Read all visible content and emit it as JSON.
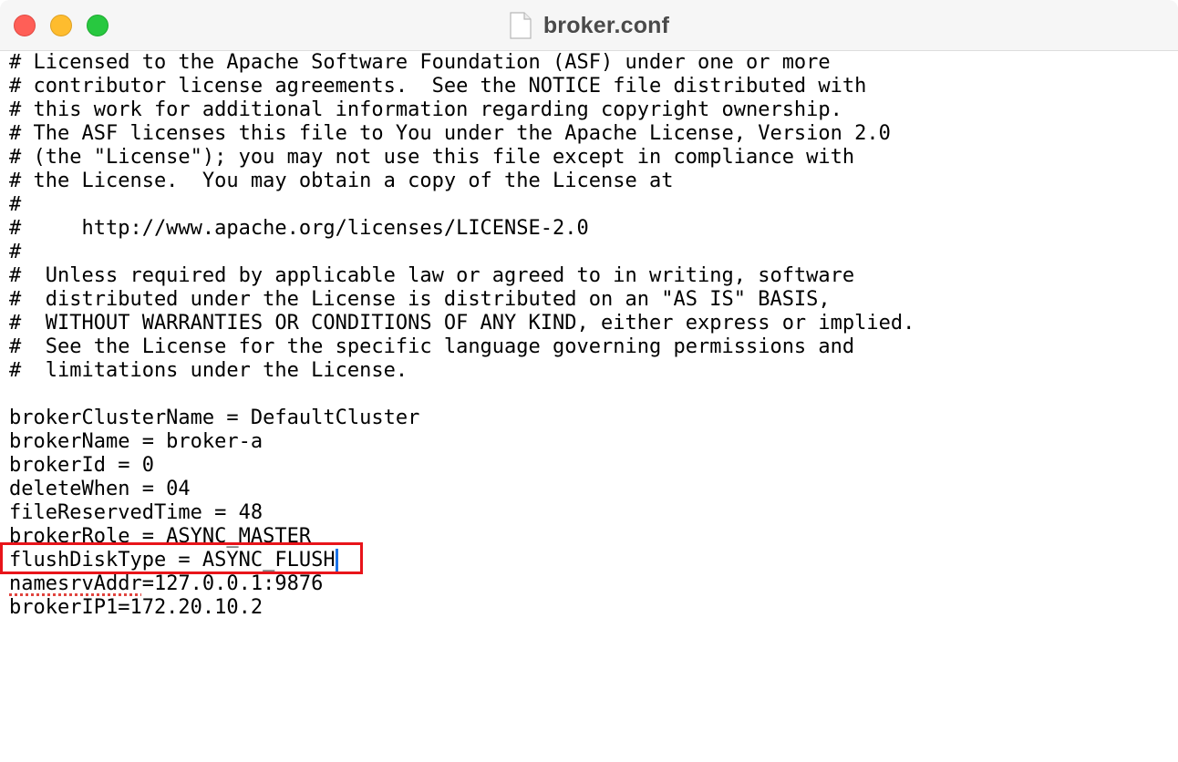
{
  "window": {
    "title": "broker.conf",
    "colors": {
      "close": "#ff5f57",
      "minimize": "#febc2e",
      "zoom": "#28c840",
      "highlight": "#e8141a",
      "cursor": "#1a73e8"
    }
  },
  "editor": {
    "lines": [
      "# Licensed to the Apache Software Foundation (ASF) under one or more",
      "# contributor license agreements.  See the NOTICE file distributed with",
      "# this work for additional information regarding copyright ownership.",
      "# The ASF licenses this file to You under the Apache License, Version 2.0",
      "# (the \"License\"); you may not use this file except in compliance with",
      "# the License.  You may obtain a copy of the License at",
      "#",
      "#     http://www.apache.org/licenses/LICENSE-2.0",
      "#",
      "#  Unless required by applicable law or agreed to in writing, software",
      "#  distributed under the License is distributed on an \"AS IS\" BASIS,",
      "#  WITHOUT WARRANTIES OR CONDITIONS OF ANY KIND, either express or implied.",
      "#  See the License for the specific language governing permissions and",
      "#  limitations under the License.",
      "",
      "brokerClusterName = DefaultCluster",
      "brokerName = broker-a",
      "brokerId = 0",
      "deleteWhen = 04",
      "fileReservedTime = 48",
      "brokerRole = ASYNC_MASTER",
      "flushDiskType = ASYNC_FLUSH",
      "namesrvAddr=127.0.0.1:9876",
      "brokerIP1=172.20.10.2"
    ],
    "spellcheck_word": "namesrvAddr",
    "spellcheck_rest": "=127.0.0.1:9876"
  },
  "icons": {
    "close": "close-window-icon",
    "minimize": "minimize-window-icon",
    "zoom": "zoom-window-icon",
    "document": "document-icon"
  }
}
